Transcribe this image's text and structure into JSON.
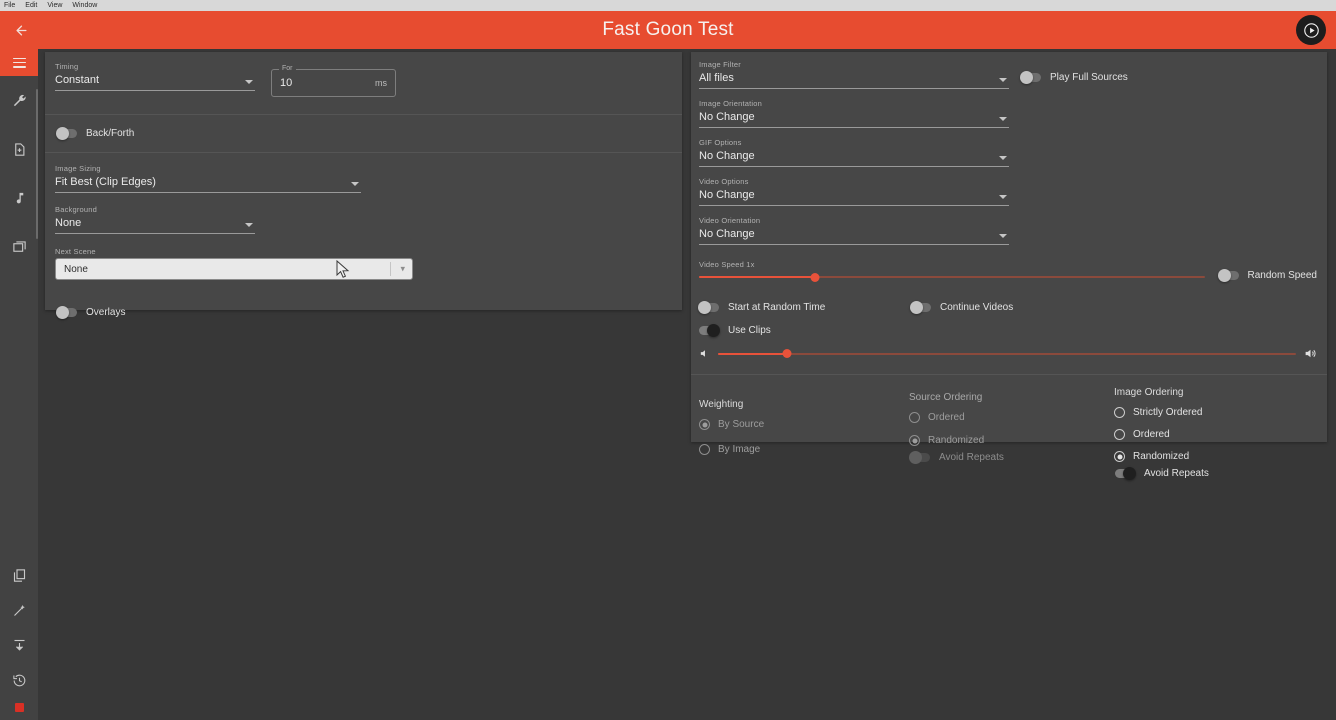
{
  "menubar": {
    "items": [
      "File",
      "Edit",
      "View",
      "Window"
    ]
  },
  "header": {
    "title": "Fast Goon Test",
    "back_icon": "back-arrow-icon",
    "play_icon": "play-circle-icon"
  },
  "sidebar": {
    "top_button": {
      "icon": "hamburger-menu-icon"
    },
    "items": [
      {
        "icon": "wrench-icon"
      },
      {
        "icon": "add-file-icon"
      },
      {
        "icon": "music-note-icon"
      },
      {
        "icon": "images-icon"
      }
    ],
    "bottom_items": [
      {
        "icon": "copy-icon"
      },
      {
        "icon": "magic-wand-icon"
      },
      {
        "icon": "import-icon"
      },
      {
        "icon": "history-icon"
      },
      {
        "icon": "record-stop-icon"
      }
    ]
  },
  "left_panel": {
    "timing": {
      "label": "Timing",
      "value": "Constant"
    },
    "duration": {
      "label": "For",
      "value": "10",
      "suffix": "ms"
    },
    "back_forth": {
      "label": "Back/Forth",
      "state": "off"
    },
    "image_sizing": {
      "label": "Image Sizing",
      "value": "Fit Best (Clip Edges)"
    },
    "background": {
      "label": "Background",
      "value": "None"
    },
    "next_scene": {
      "label": "Next Scene",
      "value": "None"
    },
    "overlays": {
      "label": "Overlays",
      "state": "off"
    }
  },
  "right_panel": {
    "image_filter": {
      "label": "Image Filter",
      "value": "All files"
    },
    "image_orientation": {
      "label": "Image Orientation",
      "value": "No Change"
    },
    "gif_options": {
      "label": "GIF Options",
      "value": "No Change"
    },
    "video_options": {
      "label": "Video Options",
      "value": "No Change"
    },
    "video_orientation": {
      "label": "Video Orientation",
      "value": "No Change"
    },
    "play_full_sources": {
      "label": "Play Full Sources",
      "state": "off"
    },
    "video_speed": {
      "label": "Video Speed 1x",
      "percent": 23
    },
    "random_speed": {
      "label": "Random Speed",
      "state": "off"
    },
    "start_at_random_time": {
      "label": "Start at Random Time",
      "state": "off"
    },
    "continue_videos": {
      "label": "Continue Videos",
      "state": "off"
    },
    "use_clips": {
      "label": "Use Clips",
      "state": "on"
    },
    "volume": {
      "percent": 12,
      "low_icon": "volume-low-icon",
      "high_icon": "volume-high-icon"
    },
    "weighting": {
      "title": "Weighting",
      "options": [
        {
          "label": "By Source",
          "selected": true
        },
        {
          "label": "By Image",
          "selected": false
        }
      ]
    },
    "source_ordering": {
      "title": "Source Ordering",
      "options": [
        {
          "label": "Ordered",
          "selected": false
        },
        {
          "label": "Randomized",
          "selected": true
        }
      ],
      "avoid_repeats": {
        "label": "Avoid Repeats",
        "state": "disabled"
      }
    },
    "image_ordering": {
      "title": "Image Ordering",
      "options": [
        {
          "label": "Strictly Ordered",
          "selected": false
        },
        {
          "label": "Ordered",
          "selected": false
        },
        {
          "label": "Randomized",
          "selected": true
        }
      ],
      "avoid_repeats": {
        "label": "Avoid Repeats",
        "state": "on"
      }
    }
  },
  "colors": {
    "accent": "#e74c30",
    "panel": "#474747",
    "background": "#373737",
    "slider": "#e8523a",
    "record": "#d93025"
  }
}
